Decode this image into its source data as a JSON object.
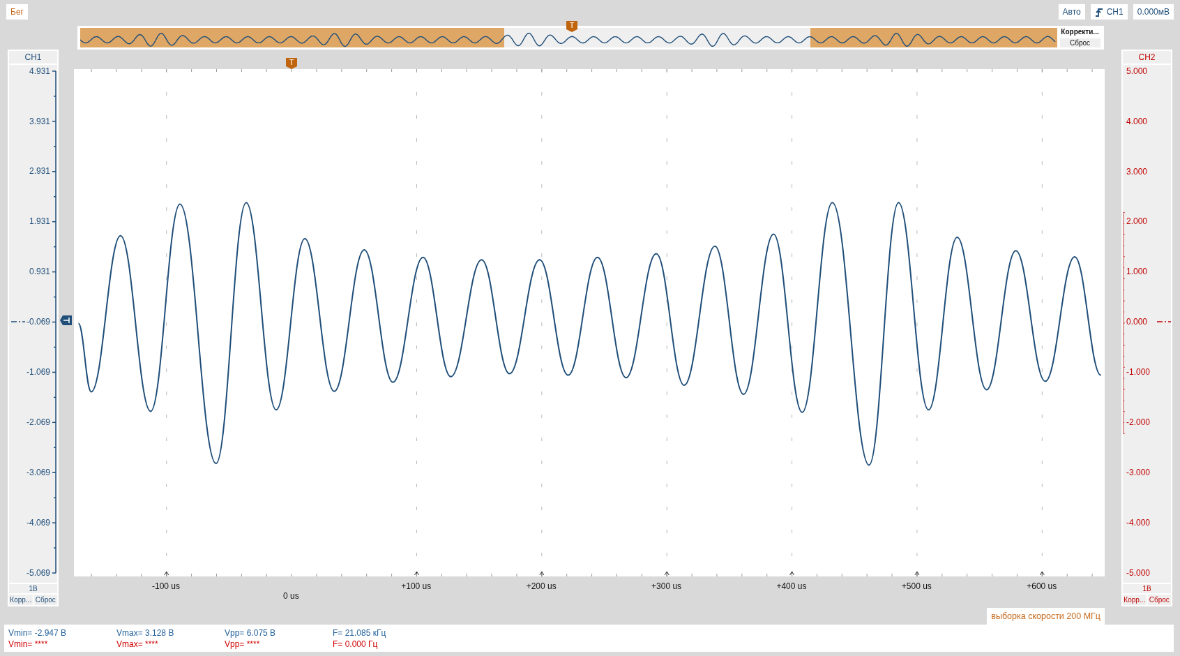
{
  "top_bar": {
    "run_button": "Бег",
    "mode_button": "Авто",
    "trigger_source_button": "CH1",
    "trigger_level": "0.000мВ"
  },
  "overview": {
    "trigger_marker": "T",
    "adjust_label": "Корректи...",
    "reset_button": "Сброс"
  },
  "channels": [
    {
      "name": "CH1",
      "color": "#1f4e79",
      "volts_per_div": "1В",
      "adjust_button": "Корр...",
      "reset_button": "Сброс"
    },
    {
      "name": "CH2",
      "color": "#c00000",
      "scale_labels": [
        "5.000",
        "4.000",
        "3.000",
        "2.000",
        "1.000",
        "0.000",
        "-1.000",
        "-2.000",
        "-3.000",
        "-4.000",
        "-5.000"
      ],
      "volts_per_div": "1В",
      "adjust_button": "Корр...",
      "reset_button": "Сброс"
    }
  ],
  "plot": {
    "trigger_marker": "T",
    "origin_label": "0 us",
    "sample_rate": "выборка скорости 200 МГц",
    "chart_data": {
      "type": "line",
      "x": [
        -170.4,
        -160.2,
        -136.7,
        -112.7,
        -89.2,
        -60.4,
        -36.3,
        -12.3,
        10.6,
        34.1,
        58.1,
        81.0,
        105.1,
        127.3,
        151.9,
        174.2,
        198.3,
        221.1,
        244.6,
        267.4,
        291.5,
        313.8,
        338.4,
        361.3,
        385.3,
        408.2,
        432.3,
        461.7,
        485.2,
        509.2,
        532.1,
        555.6,
        579.0,
        602.5,
        626.0,
        647.0
      ],
      "series": [
        {
          "color": "#1f4e79",
          "values": [
            -0.07,
            -1.43,
            1.68,
            -1.82,
            2.31,
            -2.86,
            2.34,
            -1.79,
            1.62,
            -1.42,
            1.4,
            -1.24,
            1.25,
            -1.13,
            1.2,
            -1.07,
            1.2,
            -1.1,
            1.25,
            -1.15,
            1.32,
            -1.3,
            1.47,
            -1.48,
            1.71,
            -1.84,
            2.34,
            -2.89,
            2.34,
            -1.79,
            1.65,
            -1.39,
            1.38,
            -1.22,
            1.26,
            -1.1
          ]
        }
      ],
      "xlim": [
        -174,
        650
      ],
      "ylim": [
        -5.11,
        5.0
      ],
      "grid": true,
      "yticks": [
        {
          "value": 4.931,
          "label": "4.931"
        },
        {
          "value": 3.931,
          "label": "3.931"
        },
        {
          "value": 2.931,
          "label": "2.931"
        },
        {
          "value": 1.931,
          "label": "1.931"
        },
        {
          "value": 0.931,
          "label": "0.931"
        },
        {
          "value": -0.069,
          "label": "-0.069"
        },
        {
          "value": -1.069,
          "label": "-1.069"
        },
        {
          "value": -2.069,
          "label": "-2.069"
        },
        {
          "value": -3.069,
          "label": "-3.069"
        },
        {
          "value": -4.069,
          "label": "-4.069"
        },
        {
          "value": -5.069,
          "label": "-5.069"
        }
      ],
      "xticks": [
        {
          "value": -100,
          "label": "-100 us"
        },
        {
          "value": 100,
          "label": "+100 us"
        },
        {
          "value": 200,
          "label": "+200 us"
        },
        {
          "value": 300,
          "label": "+300 us"
        },
        {
          "value": 400,
          "label": "+400 us"
        },
        {
          "value": 500,
          "label": "+500 us"
        },
        {
          "value": 600,
          "label": "+600 us"
        }
      ]
    }
  },
  "measurements": [
    {
      "color": "#1f5f99",
      "values": [
        "Vmin= -2.947 В",
        "Vmax= 3.128 В",
        "Vpp= 6.075 В",
        "F= 21.085 кГц"
      ]
    },
    {
      "color": "#d00000",
      "values": [
        "Vmin= ****",
        "Vmax= ****",
        "Vpp= ****",
        "F= 0.000 Гц"
      ]
    }
  ]
}
